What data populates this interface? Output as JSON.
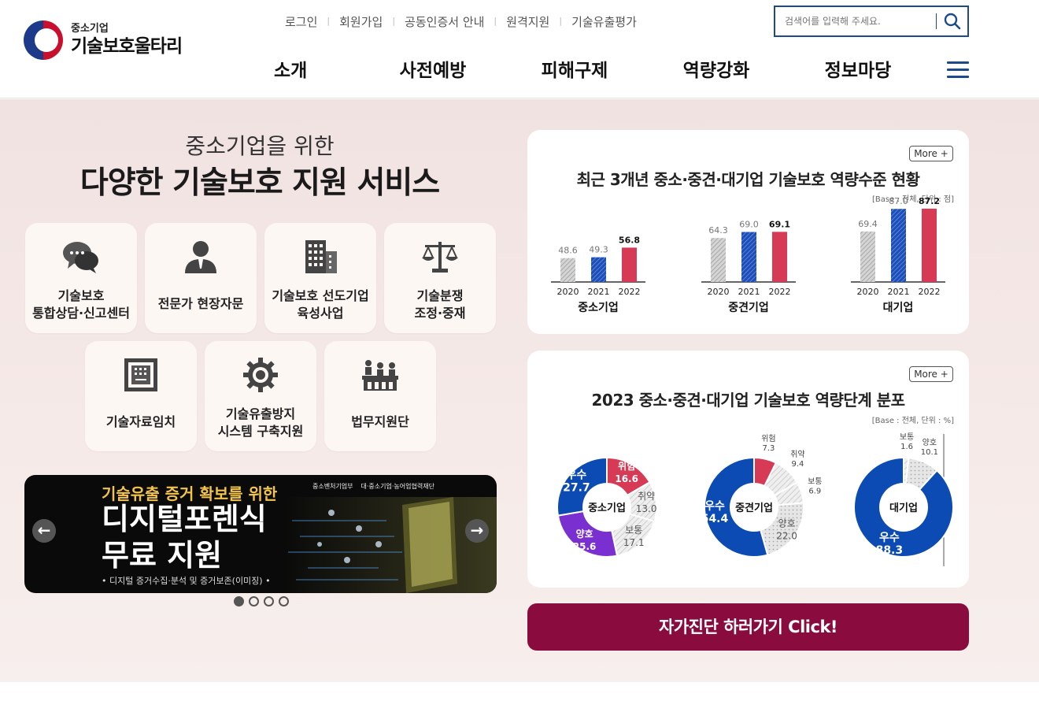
{
  "logo": {
    "sub": "중소기업",
    "main": "기술보호울타리"
  },
  "util_links": [
    "로그인",
    "회원가입",
    "공동인증서 안내",
    "원격지원",
    "기술유출평가"
  ],
  "search": {
    "placeholder": "검색어를 입력해 주세요."
  },
  "gnb": [
    "소개",
    "사전예방",
    "피해구제",
    "역량강화",
    "정보마당"
  ],
  "hero": {
    "subtitle": "중소기업을 위한",
    "title": "다양한 기술보호 지원 서비스",
    "services": [
      {
        "label": "기술보호\n통합상담·신고센터",
        "icon": "chat-icon"
      },
      {
        "label": "전문가 현장자문",
        "icon": "person-icon"
      },
      {
        "label": "기술보호 선도기업\n육성사업",
        "icon": "building-icon"
      },
      {
        "label": "기술분쟁\n조정·중재",
        "icon": "scale-icon"
      },
      {
        "label": "기술자료임치",
        "icon": "safe-icon"
      },
      {
        "label": "기술유출방지\n시스템 구축지원",
        "icon": "gear-icon"
      },
      {
        "label": "법무지원단",
        "icon": "people-icon"
      }
    ]
  },
  "banner": {
    "line1": "기술유출 증거 확보를 위한",
    "line2": "디지털포렌식",
    "line3": "무료 지원",
    "line4": "• 디지털 증거수집·분석 및 증거보존(이미징) •",
    "org1": "중소벤처기업부",
    "org2": "대·중소기업·농어업협력재단"
  },
  "chart1": {
    "more": "More +",
    "title": "최근 3개년 중소·중견·대기업 기술보호 역량수준 현황",
    "base": "[Base : 전체, 단위 : 점]",
    "colors": {
      "2020": "#bdbdbd",
      "2021": "#1e4fb8",
      "2022": "#d63a55"
    }
  },
  "chart2": {
    "more": "More +",
    "title": "2023 중소·중견·대기업 기술보호 역량단계 분포",
    "base": "[Base : 전체, 단위 : %]"
  },
  "chart_data": [
    {
      "type": "bar",
      "title": "최근 3개년 중소·중견·대기업 기술보호 역량수준 현황",
      "groups": [
        {
          "name": "중소기업",
          "categories": [
            "2020",
            "2021",
            "2022"
          ],
          "values": [
            48.6,
            49.3,
            56.8
          ]
        },
        {
          "name": "중견기업",
          "categories": [
            "2020",
            "2021",
            "2022"
          ],
          "values": [
            64.3,
            69.0,
            69.1
          ]
        },
        {
          "name": "대기업",
          "categories": [
            "2020",
            "2021",
            "2022"
          ],
          "values": [
            69.4,
            87.0,
            87.2
          ]
        }
      ]
    },
    {
      "type": "pie",
      "title": "2023 중소·중견·대기업 기술보호 역량단계 분포",
      "donuts": [
        {
          "name": "중소기업",
          "slices": [
            {
              "label": "위험",
              "value": 16.6,
              "color": "#d63a55"
            },
            {
              "label": "취약",
              "value": 13.0,
              "color": "#dcdcdc"
            },
            {
              "label": "보통",
              "value": 17.1,
              "color": "#e8e8e8"
            },
            {
              "label": "양호",
              "value": 25.6,
              "color": "#7a2fd0"
            },
            {
              "label": "우수",
              "value": 27.7,
              "color": "#0b4bb3"
            }
          ]
        },
        {
          "name": "중견기업",
          "slices": [
            {
              "label": "위험",
              "value": 7.3,
              "color": "#d63a55"
            },
            {
              "label": "취약",
              "value": 9.4,
              "color": "#dcdcdc"
            },
            {
              "label": "보통",
              "value": 6.9,
              "color": "#e8e8e8"
            },
            {
              "label": "양호",
              "value": 22.0,
              "color": "#e0e0e0"
            },
            {
              "label": "우수",
              "value": 54.4,
              "color": "#0b4bb3"
            }
          ]
        },
        {
          "name": "대기업",
          "slices": [
            {
              "label": "보통",
              "value": 1.6,
              "color": "#e8e8e8"
            },
            {
              "label": "양호",
              "value": 10.1,
              "color": "#dcdcdc"
            },
            {
              "label": "우수",
              "value": 88.3,
              "color": "#0b4bb3"
            }
          ]
        }
      ]
    }
  ],
  "cta": "자가진단 하러가기 Click!"
}
